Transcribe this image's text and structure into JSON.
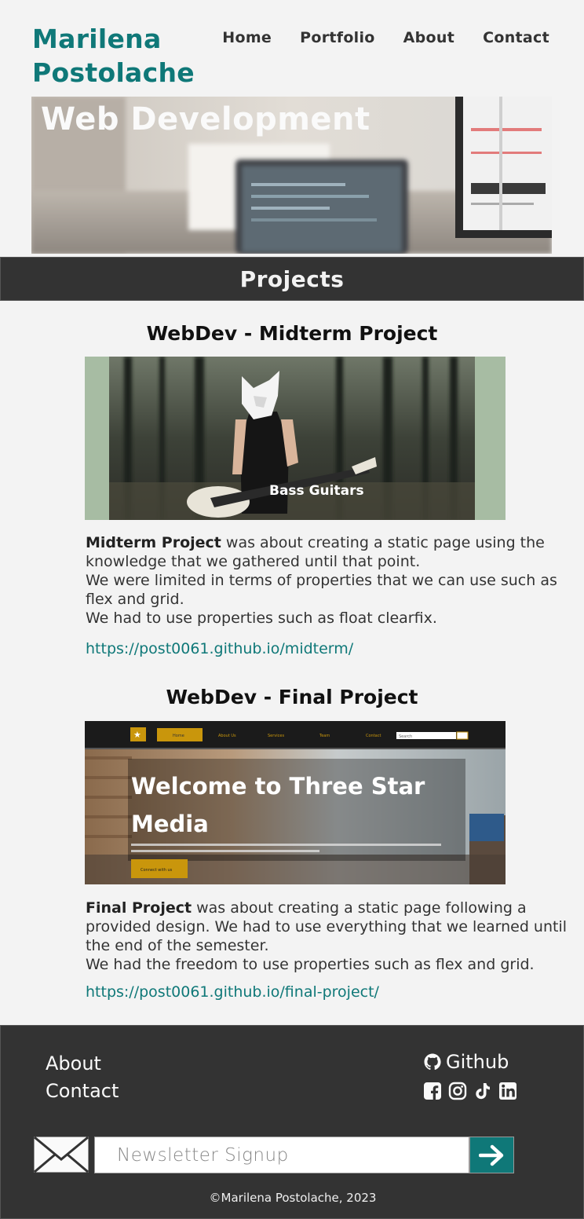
{
  "header": {
    "brand": "Marilena Postolache",
    "nav": [
      "Home",
      "Portfolio",
      "About",
      "Contact"
    ]
  },
  "hero": {
    "title": "Web Development"
  },
  "projects": {
    "heading": "Projects",
    "items": [
      {
        "title": "WebDev - Midterm Project",
        "image_caption": "Bass Guitars",
        "desc_bold": "Midterm Project",
        "desc_rest": " was about creating a static page using the knowledge that we gathered until that point.",
        "desc_line2": "We were limited in terms of properties that we can use such as flex and grid.",
        "desc_line3": "We had to use properties such as float clearfix.",
        "link": "https://post0061.github.io/midterm/"
      },
      {
        "title": "WebDev - Final Project",
        "image_nav": [
          "Home",
          "About Us",
          "Services",
          "Team",
          "Contact"
        ],
        "image_search": "Search",
        "image_headline_1": "Welcome to Three Star",
        "image_headline_2": "Media",
        "image_button": "Connect with us",
        "desc_bold": "Final Project",
        "desc_rest": " was about creating a static page following a provided design. We had to use everything that we learned until the end of the semester.",
        "desc_line2": "We had the freedom to use properties such as flex and grid.",
        "link": "https://post0061.github.io/final-project/"
      }
    ]
  },
  "footer": {
    "about": "About",
    "contact": "Contact",
    "github": "Github",
    "social_icons": [
      "facebook-icon",
      "instagram-icon",
      "tiktok-icon",
      "linkedin-icon"
    ],
    "newsletter_placeholder": "Newsletter Signup",
    "copyright": "©Marilena Postolache, 2023"
  },
  "colors": {
    "accent": "#0f7878",
    "dark": "#333333",
    "background": "#f3f3f3"
  }
}
